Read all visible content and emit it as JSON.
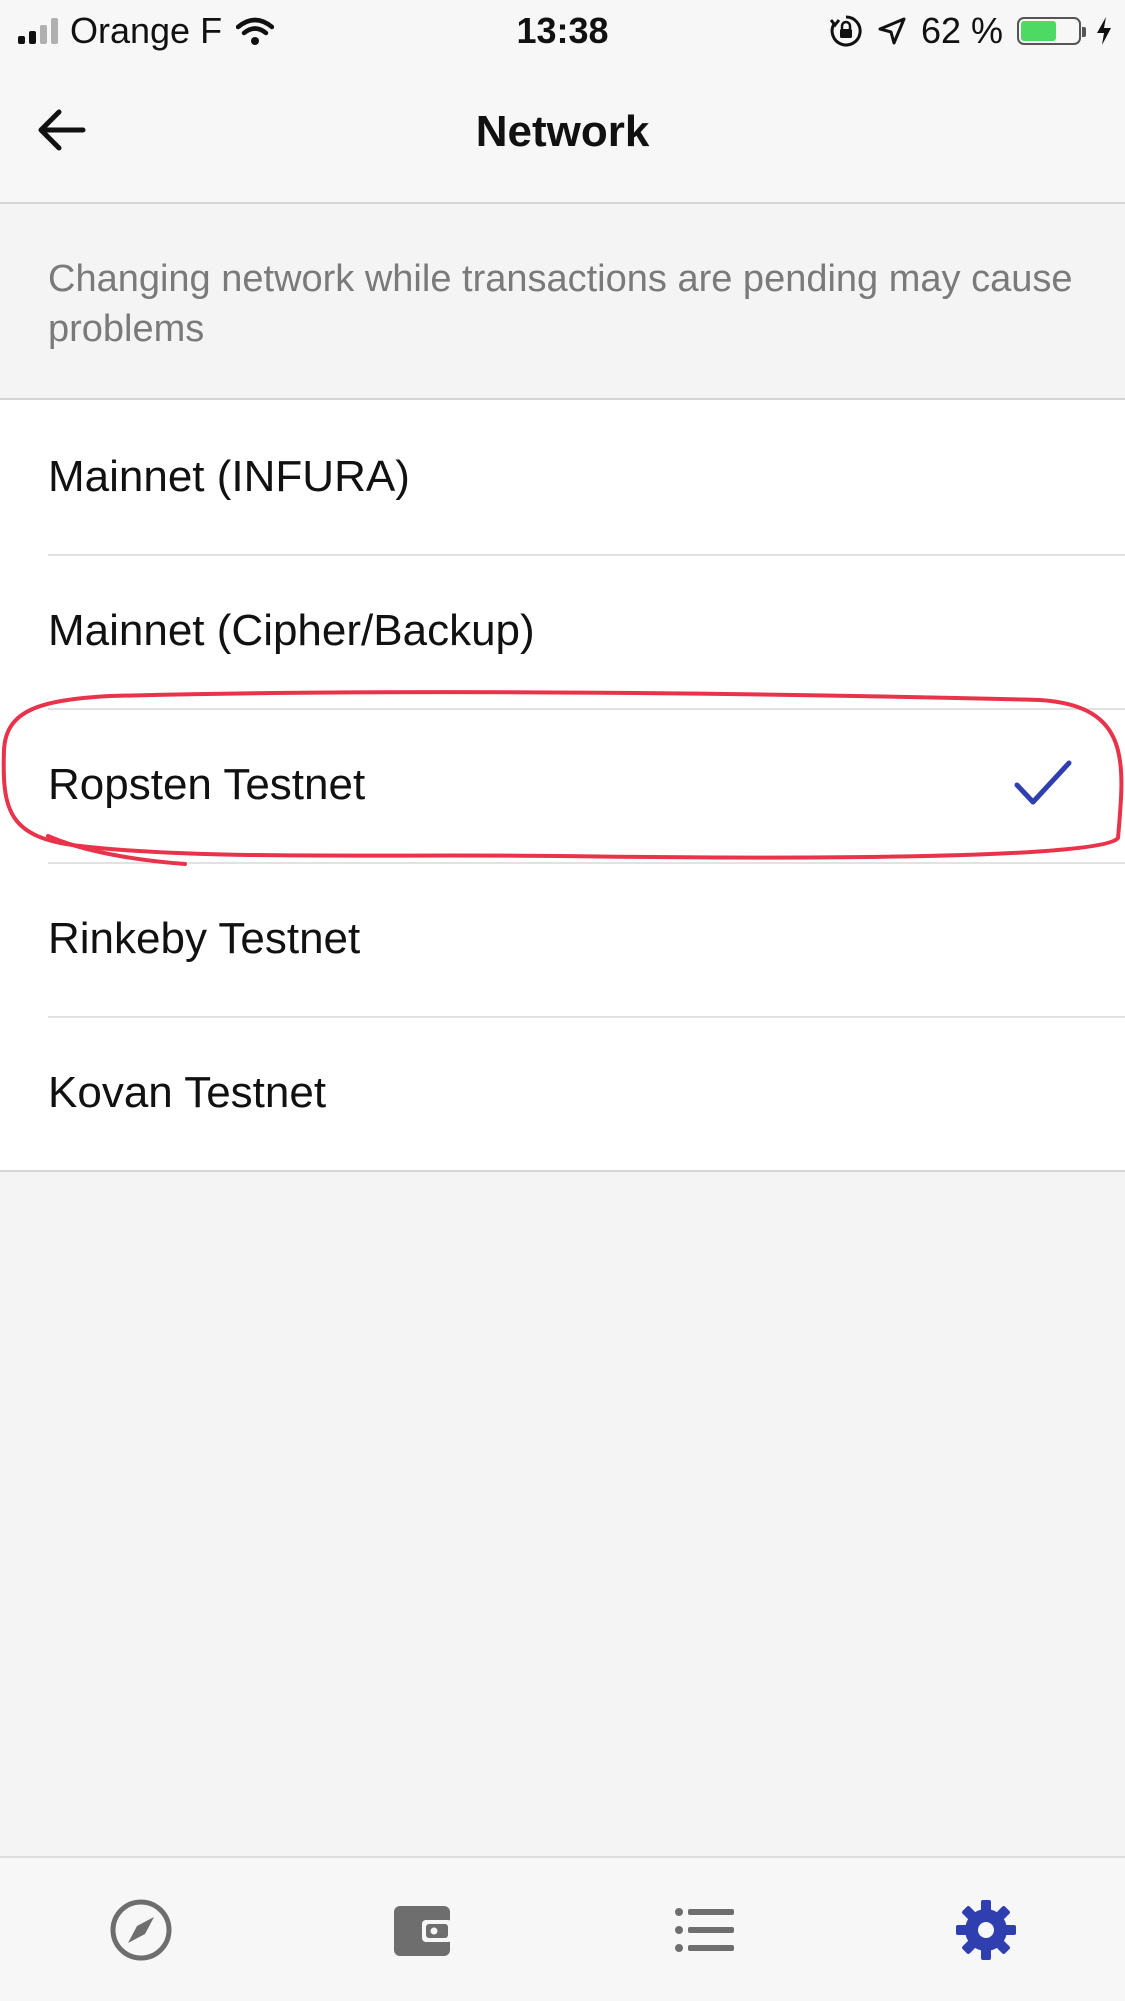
{
  "status_bar": {
    "carrier": "Orange F",
    "time": "13:38",
    "battery_text": "62 %",
    "battery_level": 0.62,
    "icons": [
      "signal-icon",
      "wifi-icon",
      "orientation-lock-icon",
      "location-icon",
      "battery-icon",
      "charging-icon"
    ]
  },
  "nav": {
    "title": "Network",
    "back_icon": "arrow-left-icon"
  },
  "warning": {
    "text": "Changing network while transactions are pending may cause problems"
  },
  "networks": [
    {
      "label": "Mainnet (INFURA)",
      "selected": false
    },
    {
      "label": "Mainnet (Cipher/Backup)",
      "selected": false
    },
    {
      "label": "Ropsten Testnet",
      "selected": true
    },
    {
      "label": "Rinkeby Testnet",
      "selected": false
    },
    {
      "label": "Kovan Testnet",
      "selected": false
    }
  ],
  "tabs": [
    {
      "name": "browser",
      "icon": "compass-icon",
      "active": false
    },
    {
      "name": "wallet",
      "icon": "wallet-icon",
      "active": false
    },
    {
      "name": "history",
      "icon": "list-icon",
      "active": false
    },
    {
      "name": "settings",
      "icon": "gear-icon",
      "active": true
    }
  ],
  "colors": {
    "accent": "#2f3fb0",
    "annotation": "#e8334a",
    "inactive_icon": "#6e6e6e",
    "battery": "#4cd964"
  }
}
